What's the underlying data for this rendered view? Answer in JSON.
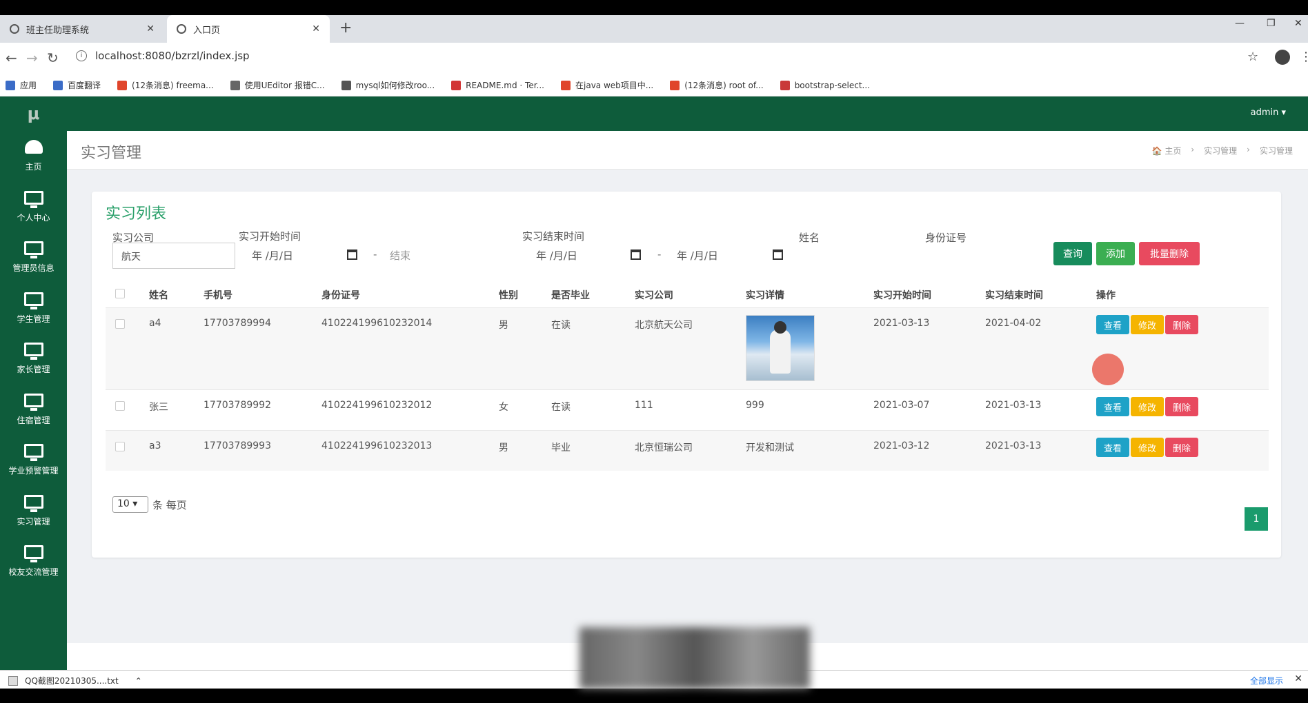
{
  "browser": {
    "tabs": [
      {
        "title": "班主任助理系统"
      },
      {
        "title": "入口页"
      }
    ],
    "url": "localhost:8080/bzrzl/index.jsp",
    "bookmarks": [
      "应用",
      "百度翻译",
      "(12条消息) freema...",
      "使用UEditor 报错C...",
      "mysql如何修改roo...",
      "README.md · Ter...",
      "在java web项目中...",
      "(12条消息) root of...",
      "bootstrap-select..."
    ],
    "bookmark_colors": [
      "#3b6cc7",
      "#3b6cc7",
      "#e0452b",
      "#666666",
      "#555555",
      "#d23636",
      "#e0452b",
      "#e0452b",
      "#c93a3a"
    ]
  },
  "app": {
    "logo": "μ",
    "user": "admin ▾",
    "sidebar": [
      {
        "label": "主页",
        "icon": "dashboard-icon"
      },
      {
        "label": "个人中心",
        "icon": "monitor-icon"
      },
      {
        "label": "管理员信息",
        "icon": "monitor-icon"
      },
      {
        "label": "学生管理",
        "icon": "monitor-icon"
      },
      {
        "label": "家长管理",
        "icon": "monitor-icon"
      },
      {
        "label": "住宿管理",
        "icon": "monitor-icon"
      },
      {
        "label": "学业预警管理",
        "icon": "monitor-icon"
      },
      {
        "label": "实习管理",
        "icon": "monitor-icon"
      },
      {
        "label": "校友交流管理",
        "icon": "monitor-icon"
      }
    ],
    "page_title": "实习管理",
    "breadcrumb": [
      "🏠 主页",
      "›",
      "实习管理",
      "›",
      "实习管理"
    ]
  },
  "card": {
    "title": "实习列表",
    "filters": {
      "company_label": "实习公司",
      "company_value": "航天",
      "start_label": "实习开始时间",
      "start_from": "年 /月/日",
      "start_to_placeholder": "结束",
      "end_label": "实习结束时间",
      "end_from": "年 /月/日",
      "end_to": "年 /月/日",
      "name_label": "姓名",
      "id_label": "身份证号",
      "dash": "-"
    },
    "buttons": {
      "search": "查询",
      "add": "添加",
      "batch_delete": "批量删除"
    },
    "columns": [
      "姓名",
      "手机号",
      "身份证号",
      "性别",
      "是否毕业",
      "实习公司",
      "实习详情",
      "实习开始时间",
      "实习结束时间",
      "操作"
    ],
    "rows": [
      {
        "name": "a4",
        "phone": "17703789994",
        "id": "410224199610232014",
        "gender": "男",
        "graduated": "在读",
        "company": "北京航天公司",
        "detail": "",
        "start": "2021-03-13",
        "end": "2021-04-02"
      },
      {
        "name": "张三",
        "phone": "17703789992",
        "id": "410224199610232012",
        "gender": "女",
        "graduated": "在读",
        "company": "111",
        "detail": "999",
        "start": "2021-03-07",
        "end": "2021-03-13"
      },
      {
        "name": "a3",
        "phone": "17703789993",
        "id": "410224199610232013",
        "gender": "男",
        "graduated": "毕业",
        "company": "北京恒瑞公司",
        "detail": "开发和测试",
        "start": "2021-03-12",
        "end": "2021-03-13"
      }
    ],
    "row_actions": {
      "view": "查看",
      "edit": "修改",
      "delete": "删除"
    },
    "page_size": "10",
    "page_size_suffix": "条 每页",
    "current_page": "1"
  },
  "downloads": {
    "file": "QQ截图20210305....txt",
    "show_all": "全部显示"
  },
  "colors": {
    "primary": "#0e5c3b",
    "accent": "#2aa06a",
    "info": "#1ea2c7",
    "warning": "#f5b400",
    "danger": "#e84a5f"
  }
}
